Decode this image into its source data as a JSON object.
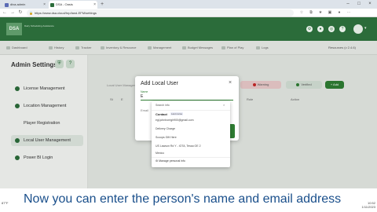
{
  "browser": {
    "tabs": [
      {
        "label": "diva.admin",
        "icon": "grid-tab-icon",
        "color": "#5b6bb5",
        "active": false
      },
      {
        "label": "DSA - Oasis",
        "icon": "dsa-tab-icon",
        "color": "#2b6c3a",
        "active": true
      }
    ],
    "url": "https://www.dsa.cloud/hrp/land-EFM/settings"
  },
  "app": {
    "logo": "DSA",
    "logo_text": "Dairy Scheduling Assistance",
    "nav": [
      "Dashboard",
      "History",
      "Tracker",
      "Inventory & Resource",
      "Management",
      "Budget Messages",
      "Plan of Play",
      "Logs"
    ],
    "language": "Resources (v 2.4.6)"
  },
  "sidebar": {
    "title": "Admin Settings",
    "items": [
      {
        "label": "License Management",
        "active": false
      },
      {
        "label": "Location Management",
        "active": false
      },
      {
        "label": "Player Registration",
        "active": false
      },
      {
        "label": "Local User Management",
        "active": true
      },
      {
        "label": "Power BI Login",
        "active": false
      }
    ]
  },
  "main": {
    "local_label": "Local User Management",
    "column_headers": [
      "St",
      "E",
      "Role",
      "Action"
    ],
    "pill_red": "Warning",
    "pill_green": "Verified",
    "add_button": "+ Add"
  },
  "modal": {
    "title": "Add Local User",
    "close": "×",
    "field_label": "Name",
    "field_value": "E",
    "field2_label": "Email",
    "suggestions": {
      "search": "Search info",
      "section": "Contact",
      "badge": "Last name",
      "lines": [
        "egl.johnhorrigh900@gmail.com",
        "Delivery Charge",
        "Scoops Gift Here",
        "US Lawson Rd  Y - IOTA, Tessa OE 2",
        "Mexico"
      ],
      "manage": "Manage personal info"
    }
  },
  "caption": "Now you can enter the person's name and email address",
  "taskbar": {
    "weather": "87°F",
    "time": "10:52",
    "date": "1/11/2023"
  },
  "colors": {
    "brand": "#2b6c3a",
    "caption_text": "#1a4f8b"
  }
}
